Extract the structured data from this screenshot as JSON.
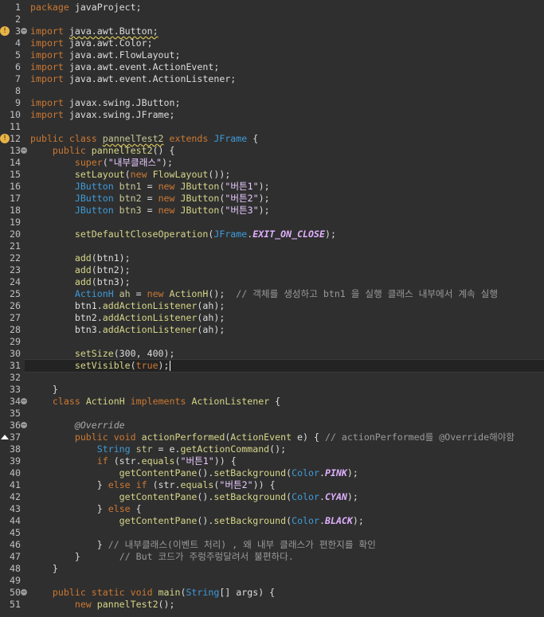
{
  "editor": {
    "current_line": 31,
    "lines": [
      {
        "n": "1",
        "tokens": [
          {
            "t": "package ",
            "c": "kw"
          },
          {
            "t": "javaProject;",
            "c": "plain"
          }
        ]
      },
      {
        "n": "2",
        "tokens": []
      },
      {
        "n": "3",
        "fold": true,
        "warn": true,
        "tokens": [
          {
            "t": "import ",
            "c": "kw"
          },
          {
            "t": "java.awt.Button;",
            "c": "plain",
            "squig": true
          }
        ]
      },
      {
        "n": "4",
        "tokens": [
          {
            "t": "import ",
            "c": "kw"
          },
          {
            "t": "java.awt.Color;",
            "c": "plain"
          }
        ]
      },
      {
        "n": "5",
        "tokens": [
          {
            "t": "import ",
            "c": "kw"
          },
          {
            "t": "java.awt.FlowLayout;",
            "c": "plain"
          }
        ]
      },
      {
        "n": "6",
        "tokens": [
          {
            "t": "import ",
            "c": "kw"
          },
          {
            "t": "java.awt.event.ActionEvent;",
            "c": "plain"
          }
        ]
      },
      {
        "n": "7",
        "tokens": [
          {
            "t": "import ",
            "c": "kw"
          },
          {
            "t": "java.awt.event.ActionListener;",
            "c": "plain"
          }
        ]
      },
      {
        "n": "8",
        "tokens": []
      },
      {
        "n": "9",
        "tokens": [
          {
            "t": "import ",
            "c": "kw"
          },
          {
            "t": "javax.swing.JButton;",
            "c": "plain"
          }
        ]
      },
      {
        "n": "10",
        "tokens": [
          {
            "t": "import ",
            "c": "kw"
          },
          {
            "t": "javax.swing.JFrame;",
            "c": "plain"
          }
        ]
      },
      {
        "n": "11",
        "tokens": []
      },
      {
        "n": "12",
        "warn": true,
        "tokens": [
          {
            "t": "public class ",
            "c": "kw"
          },
          {
            "t": "pannelTest2",
            "c": "type",
            "squig": true
          },
          {
            "t": " extends ",
            "c": "kw"
          },
          {
            "t": "JFrame",
            "c": "cls"
          },
          {
            "t": " {",
            "c": "plain"
          }
        ]
      },
      {
        "n": "13",
        "fold": true,
        "tokens": [
          {
            "t": "    public ",
            "c": "kw"
          },
          {
            "t": "pannelTest2",
            "c": "method"
          },
          {
            "t": "() {",
            "c": "plain"
          }
        ]
      },
      {
        "n": "14",
        "tokens": [
          {
            "t": "        super",
            "c": "kw"
          },
          {
            "t": "(",
            "c": "plain"
          },
          {
            "t": "\"내부클래스\"",
            "c": "str"
          },
          {
            "t": ");",
            "c": "plain"
          }
        ]
      },
      {
        "n": "15",
        "tokens": [
          {
            "t": "        setLayout",
            "c": "method"
          },
          {
            "t": "(",
            "c": "plain"
          },
          {
            "t": "new ",
            "c": "kw"
          },
          {
            "t": "FlowLayout",
            "c": "method"
          },
          {
            "t": "());",
            "c": "plain"
          }
        ]
      },
      {
        "n": "16",
        "tokens": [
          {
            "t": "        JButton",
            "c": "cls"
          },
          {
            "t": " btn1 ",
            "c": "type"
          },
          {
            "t": "= ",
            "c": "plain"
          },
          {
            "t": "new ",
            "c": "kw"
          },
          {
            "t": "JButton",
            "c": "method"
          },
          {
            "t": "(",
            "c": "plain"
          },
          {
            "t": "\"버튼1\"",
            "c": "str"
          },
          {
            "t": ");",
            "c": "plain"
          }
        ]
      },
      {
        "n": "17",
        "tokens": [
          {
            "t": "        JButton",
            "c": "cls"
          },
          {
            "t": " btn2 ",
            "c": "type"
          },
          {
            "t": "= ",
            "c": "plain"
          },
          {
            "t": "new ",
            "c": "kw"
          },
          {
            "t": "JButton",
            "c": "method"
          },
          {
            "t": "(",
            "c": "plain"
          },
          {
            "t": "\"버튼2\"",
            "c": "str"
          },
          {
            "t": ");",
            "c": "plain"
          }
        ]
      },
      {
        "n": "18",
        "tokens": [
          {
            "t": "        JButton",
            "c": "cls"
          },
          {
            "t": " btn3 ",
            "c": "type"
          },
          {
            "t": "= ",
            "c": "plain"
          },
          {
            "t": "new ",
            "c": "kw"
          },
          {
            "t": "JButton",
            "c": "method"
          },
          {
            "t": "(",
            "c": "plain"
          },
          {
            "t": "\"버튼3\"",
            "c": "str"
          },
          {
            "t": ");",
            "c": "plain"
          }
        ]
      },
      {
        "n": "19",
        "tokens": []
      },
      {
        "n": "20",
        "tokens": [
          {
            "t": "        setDefaultCloseOperation",
            "c": "method"
          },
          {
            "t": "(",
            "c": "plain"
          },
          {
            "t": "JFrame",
            "c": "cls"
          },
          {
            "t": ".",
            "c": "plain"
          },
          {
            "t": "EXIT_ON_CLOSE",
            "c": "const"
          },
          {
            "t": ");",
            "c": "plain"
          }
        ]
      },
      {
        "n": "21",
        "tokens": []
      },
      {
        "n": "22",
        "tokens": [
          {
            "t": "        add",
            "c": "method"
          },
          {
            "t": "(btn1);",
            "c": "plain"
          }
        ]
      },
      {
        "n": "23",
        "tokens": [
          {
            "t": "        add",
            "c": "method"
          },
          {
            "t": "(btn2);",
            "c": "plain"
          }
        ]
      },
      {
        "n": "24",
        "tokens": [
          {
            "t": "        add",
            "c": "method"
          },
          {
            "t": "(btn3);",
            "c": "plain"
          }
        ]
      },
      {
        "n": "25",
        "tokens": [
          {
            "t": "        ActionH",
            "c": "cls"
          },
          {
            "t": " ah ",
            "c": "type"
          },
          {
            "t": "= ",
            "c": "plain"
          },
          {
            "t": "new ",
            "c": "kw"
          },
          {
            "t": "ActionH",
            "c": "method"
          },
          {
            "t": "();  ",
            "c": "plain"
          },
          {
            "t": "// 객체를 생성하고 btn1 을 실행 클래스 내부에서 계속 실행",
            "c": "comment"
          }
        ]
      },
      {
        "n": "26",
        "tokens": [
          {
            "t": "        btn1.",
            "c": "plain"
          },
          {
            "t": "addActionListener",
            "c": "method"
          },
          {
            "t": "(ah);",
            "c": "plain"
          }
        ]
      },
      {
        "n": "27",
        "tokens": [
          {
            "t": "        btn2.",
            "c": "plain"
          },
          {
            "t": "addActionListener",
            "c": "method"
          },
          {
            "t": "(ah);",
            "c": "plain"
          }
        ]
      },
      {
        "n": "28",
        "tokens": [
          {
            "t": "        btn3.",
            "c": "plain"
          },
          {
            "t": "addActionListener",
            "c": "method"
          },
          {
            "t": "(ah);",
            "c": "plain"
          }
        ]
      },
      {
        "n": "29",
        "tokens": []
      },
      {
        "n": "30",
        "tokens": [
          {
            "t": "        setSize",
            "c": "method"
          },
          {
            "t": "(300, 400);",
            "c": "plain"
          }
        ]
      },
      {
        "n": "31",
        "caret": true,
        "tokens": [
          {
            "t": "        setVisible",
            "c": "method"
          },
          {
            "t": "(",
            "c": "plain"
          },
          {
            "t": "true",
            "c": "kw"
          },
          {
            "t": ");",
            "c": "plain"
          }
        ]
      },
      {
        "n": "32",
        "tokens": []
      },
      {
        "n": "33",
        "tokens": [
          {
            "t": "    }",
            "c": "plain"
          }
        ]
      },
      {
        "n": "34",
        "fold": true,
        "tokens": [
          {
            "t": "    class ",
            "c": "kw"
          },
          {
            "t": "ActionH",
            "c": "method"
          },
          {
            "t": " implements ",
            "c": "kw"
          },
          {
            "t": "ActionListener",
            "c": "method"
          },
          {
            "t": " {",
            "c": "plain"
          }
        ]
      },
      {
        "n": "35",
        "tokens": []
      },
      {
        "n": "36",
        "fold": true,
        "tokens": [
          {
            "t": "        @Override",
            "c": "anno"
          }
        ]
      },
      {
        "n": "37",
        "override": true,
        "tokens": [
          {
            "t": "        public void ",
            "c": "kw"
          },
          {
            "t": "actionPerformed",
            "c": "method"
          },
          {
            "t": "(",
            "c": "plain"
          },
          {
            "t": "ActionEvent",
            "c": "method"
          },
          {
            "t": " e) { ",
            "c": "plain"
          },
          {
            "t": "// actionPerformed를 @Override해야함",
            "c": "comment"
          }
        ]
      },
      {
        "n": "38",
        "tokens": [
          {
            "t": "            String",
            "c": "cls"
          },
          {
            "t": " str ",
            "c": "type"
          },
          {
            "t": "= e.",
            "c": "plain"
          },
          {
            "t": "getActionCommand",
            "c": "method"
          },
          {
            "t": "();",
            "c": "plain"
          }
        ]
      },
      {
        "n": "39",
        "tokens": [
          {
            "t": "            if ",
            "c": "kw"
          },
          {
            "t": "(str.",
            "c": "plain"
          },
          {
            "t": "equals",
            "c": "method"
          },
          {
            "t": "(",
            "c": "plain"
          },
          {
            "t": "\"버튼1\"",
            "c": "str"
          },
          {
            "t": ")) {",
            "c": "plain"
          }
        ]
      },
      {
        "n": "40",
        "tokens": [
          {
            "t": "                getContentPane",
            "c": "method"
          },
          {
            "t": "().",
            "c": "plain"
          },
          {
            "t": "setBackground",
            "c": "method"
          },
          {
            "t": "(",
            "c": "plain"
          },
          {
            "t": "Color",
            "c": "cls"
          },
          {
            "t": ".",
            "c": "plain"
          },
          {
            "t": "PINK",
            "c": "const"
          },
          {
            "t": ");",
            "c": "plain"
          }
        ]
      },
      {
        "n": "41",
        "tokens": [
          {
            "t": "            } ",
            "c": "plain"
          },
          {
            "t": "else if ",
            "c": "kw"
          },
          {
            "t": "(str.",
            "c": "plain"
          },
          {
            "t": "equals",
            "c": "method"
          },
          {
            "t": "(",
            "c": "plain"
          },
          {
            "t": "\"버튼2\"",
            "c": "str"
          },
          {
            "t": ")) {",
            "c": "plain"
          }
        ]
      },
      {
        "n": "42",
        "tokens": [
          {
            "t": "                getContentPane",
            "c": "method"
          },
          {
            "t": "().",
            "c": "plain"
          },
          {
            "t": "setBackground",
            "c": "method"
          },
          {
            "t": "(",
            "c": "plain"
          },
          {
            "t": "Color",
            "c": "cls"
          },
          {
            "t": ".",
            "c": "plain"
          },
          {
            "t": "CYAN",
            "c": "const"
          },
          {
            "t": ");",
            "c": "plain"
          }
        ]
      },
      {
        "n": "43",
        "tokens": [
          {
            "t": "            } ",
            "c": "plain"
          },
          {
            "t": "else ",
            "c": "kw"
          },
          {
            "t": "{",
            "c": "plain"
          }
        ]
      },
      {
        "n": "44",
        "tokens": [
          {
            "t": "                getContentPane",
            "c": "method"
          },
          {
            "t": "().",
            "c": "plain"
          },
          {
            "t": "setBackground",
            "c": "method"
          },
          {
            "t": "(",
            "c": "plain"
          },
          {
            "t": "Color",
            "c": "cls"
          },
          {
            "t": ".",
            "c": "plain"
          },
          {
            "t": "BLACK",
            "c": "const"
          },
          {
            "t": ");",
            "c": "plain"
          }
        ]
      },
      {
        "n": "45",
        "tokens": []
      },
      {
        "n": "46",
        "tokens": [
          {
            "t": "            } ",
            "c": "plain"
          },
          {
            "t": "// 내부클래스(이벤트 처리) , 왜 내부 클래스가 편한지를 확인",
            "c": "comment"
          }
        ]
      },
      {
        "n": "47",
        "tokens": [
          {
            "t": "        }       ",
            "c": "plain"
          },
          {
            "t": "// But 코드가 주렁주렁달려서 불편하다.",
            "c": "comment"
          }
        ]
      },
      {
        "n": "48",
        "tokens": [
          {
            "t": "    }",
            "c": "plain"
          }
        ]
      },
      {
        "n": "49",
        "tokens": []
      },
      {
        "n": "50",
        "fold": true,
        "tokens": [
          {
            "t": "    public static void ",
            "c": "kw"
          },
          {
            "t": "main",
            "c": "method"
          },
          {
            "t": "(",
            "c": "plain"
          },
          {
            "t": "String",
            "c": "cls"
          },
          {
            "t": "[] args) {",
            "c": "plain"
          }
        ]
      },
      {
        "n": "51",
        "tokens": [
          {
            "t": "        new ",
            "c": "kw"
          },
          {
            "t": "pannelTest2",
            "c": "method"
          },
          {
            "t": "();",
            "c": "plain"
          }
        ]
      }
    ]
  }
}
